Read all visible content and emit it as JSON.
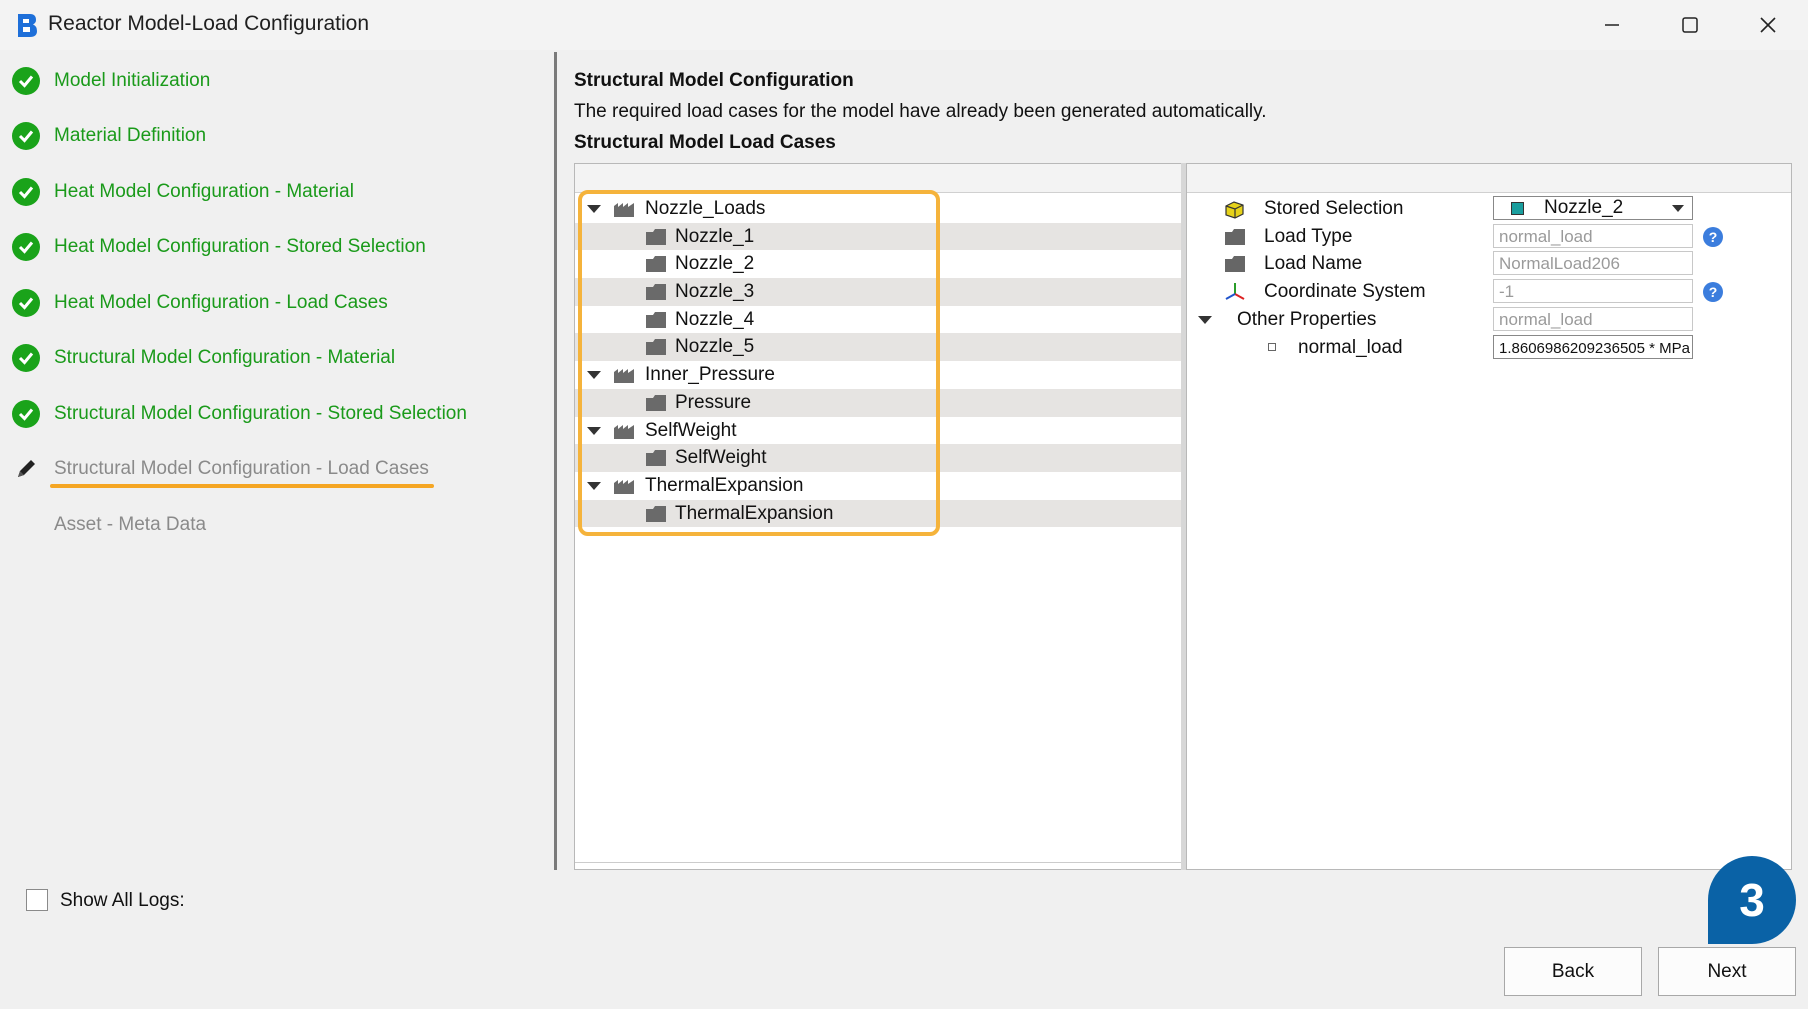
{
  "window": {
    "title": "Reactor Model-Load Configuration",
    "controls": [
      "minimize",
      "maximize",
      "close"
    ]
  },
  "sidebar": {
    "steps": [
      {
        "label": "Model Initialization",
        "status": "done"
      },
      {
        "label": "Material Definition",
        "status": "done"
      },
      {
        "label": "Heat Model Configuration - Material",
        "status": "done"
      },
      {
        "label": "Heat Model Configuration - Stored Selection",
        "status": "done"
      },
      {
        "label": "Heat Model Configuration - Load Cases",
        "status": "done"
      },
      {
        "label": "Structural Model Configuration - Material",
        "status": "done"
      },
      {
        "label": "Structural Model Configuration - Stored Selection",
        "status": "done"
      },
      {
        "label": "Structural Model Configuration - Load Cases",
        "status": "active"
      },
      {
        "label": "Asset - Meta Data",
        "status": "pending"
      }
    ],
    "show_logs_label": "Show All Logs:",
    "show_logs_checked": false
  },
  "main": {
    "title": "Structural Model Configuration",
    "description": "The required load cases for the model have already been generated automatically.",
    "subtitle": "Structural Model Load Cases"
  },
  "tree": {
    "groups": [
      {
        "label": "Nozzle_Loads",
        "children": [
          "Nozzle_1",
          "Nozzle_2",
          "Nozzle_3",
          "Nozzle_4",
          "Nozzle_5"
        ]
      },
      {
        "label": "Inner_Pressure",
        "children": [
          "Pressure"
        ]
      },
      {
        "label": "SelfWeight",
        "children": [
          "SelfWeight"
        ]
      },
      {
        "label": "ThermalExpansion",
        "children": [
          "ThermalExpansion"
        ]
      }
    ]
  },
  "properties": {
    "stored_selection": {
      "label": "Stored Selection",
      "value": "Nozzle_2"
    },
    "load_type": {
      "label": "Load Type",
      "value": "normal_load"
    },
    "load_name": {
      "label": "Load Name",
      "value": "NormalLoad206"
    },
    "coordinate_system": {
      "label": "Coordinate System",
      "value": "-1"
    },
    "other_properties": {
      "label": "Other Properties",
      "value": "normal_load"
    },
    "normal_load": {
      "label": "normal_load",
      "value": "1.8606986209236505 * MPa"
    }
  },
  "buttons": {
    "back": "Back",
    "next": "Next"
  },
  "step_badge": "3",
  "colors": {
    "done_green": "#1a9a1a",
    "highlight_orange": "#f5a623",
    "badge_blue": "#0a62a6"
  }
}
